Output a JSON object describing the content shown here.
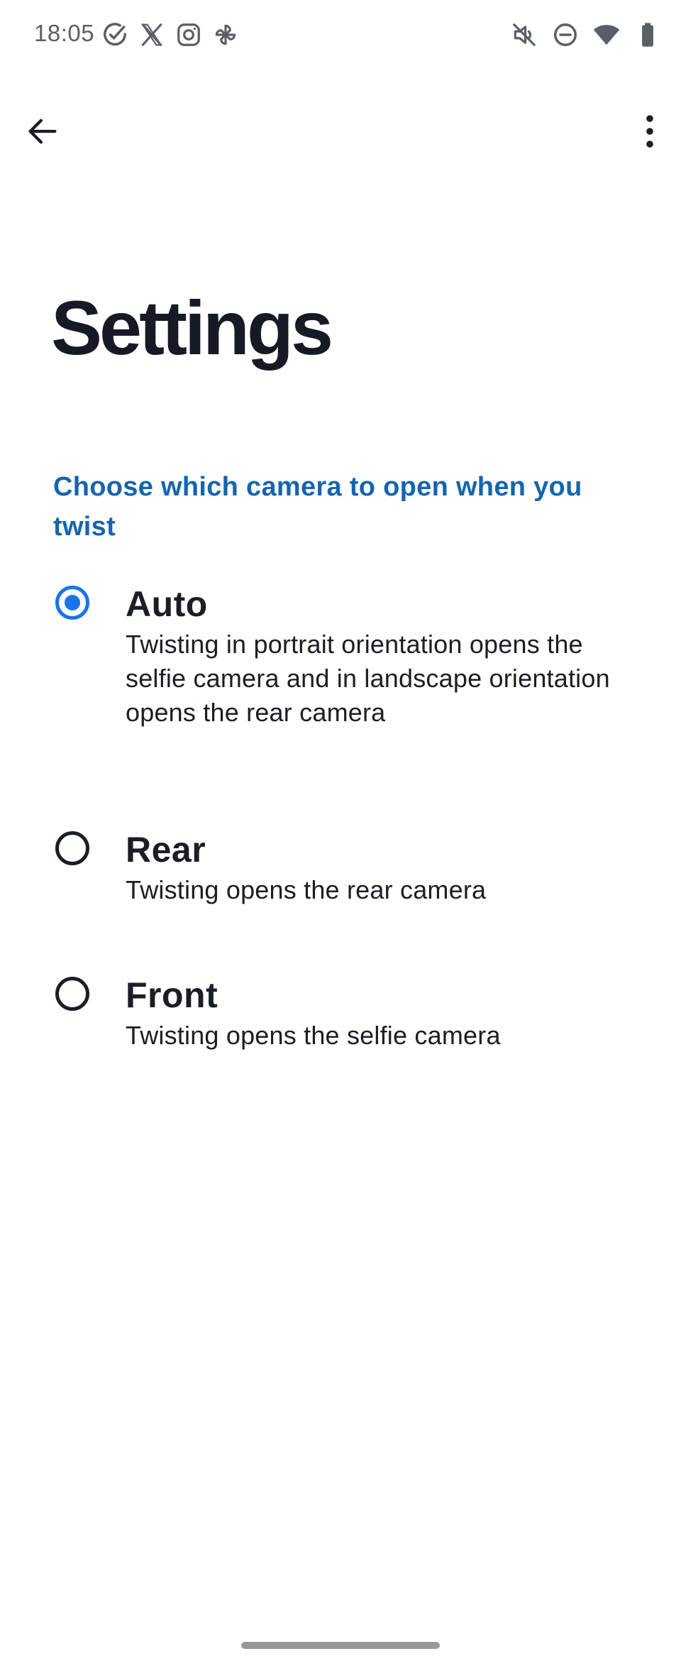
{
  "status_bar": {
    "time": "18:05",
    "left_icons": [
      "check-circle-icon",
      "x-icon",
      "instagram-icon",
      "pinwheel-icon"
    ],
    "right_icons": [
      "muted-icon",
      "do-not-disturb-icon",
      "wifi-icon",
      "battery-icon"
    ]
  },
  "toolbar": {
    "back_icon": "arrow-left-icon",
    "more_icon": "more-vert-icon"
  },
  "page": {
    "title": "Settings",
    "section_header": "Choose which camera to open when you twist"
  },
  "options": [
    {
      "title": "Auto",
      "description": "Twisting in portrait orientation opens the selfie camera and in landscape orientation opens the rear camera",
      "selected": true
    },
    {
      "title": "Rear",
      "description": "Twisting opens the rear camera",
      "selected": false
    },
    {
      "title": "Front",
      "description": "Twisting opens the selfie camera",
      "selected": false
    }
  ],
  "colors": {
    "accent": "#1a73e8",
    "section_header": "#1565b0",
    "text_primary": "#1b1e26",
    "status_text": "#5a5f66"
  }
}
